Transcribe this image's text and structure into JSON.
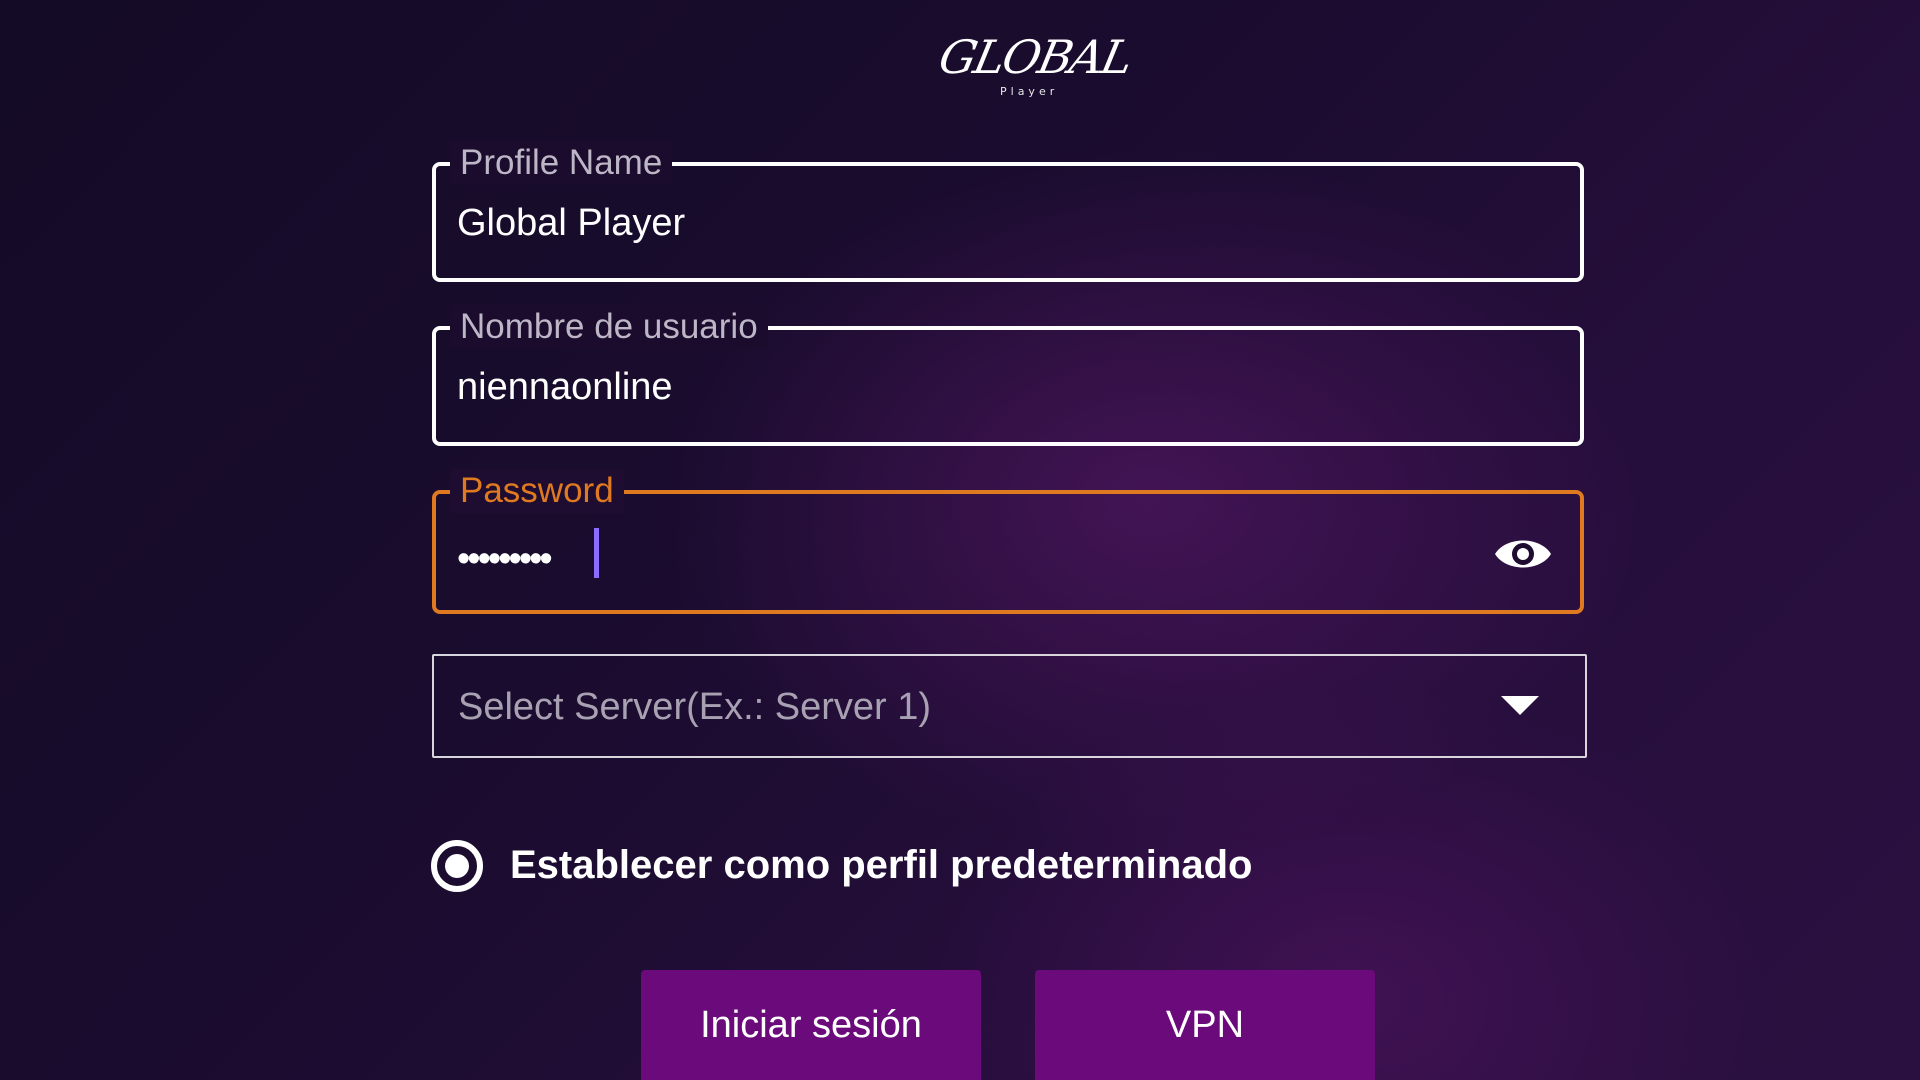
{
  "logo": {
    "script_text": "GLOBAL",
    "sub_text": "Player"
  },
  "fields": {
    "profile": {
      "label": "Profile Name",
      "value": "Global Player"
    },
    "username": {
      "label": "Nombre de usuario",
      "value": "niennaonline"
    },
    "password": {
      "label": "Password",
      "masked_value": "•••••••••",
      "show_icon": "eye-icon"
    }
  },
  "server_select": {
    "placeholder": "Select Server(Ex.: Server 1)",
    "icon": "chevron-down-icon"
  },
  "default_profile": {
    "label": "Establecer como perfil predeterminado",
    "checked": true
  },
  "buttons": {
    "login": "Iniciar sesión",
    "vpn": "VPN"
  },
  "colors": {
    "accent_orange": "#e07a20",
    "button_purple": "#6b0a7b",
    "caret": "#8a6cff"
  }
}
